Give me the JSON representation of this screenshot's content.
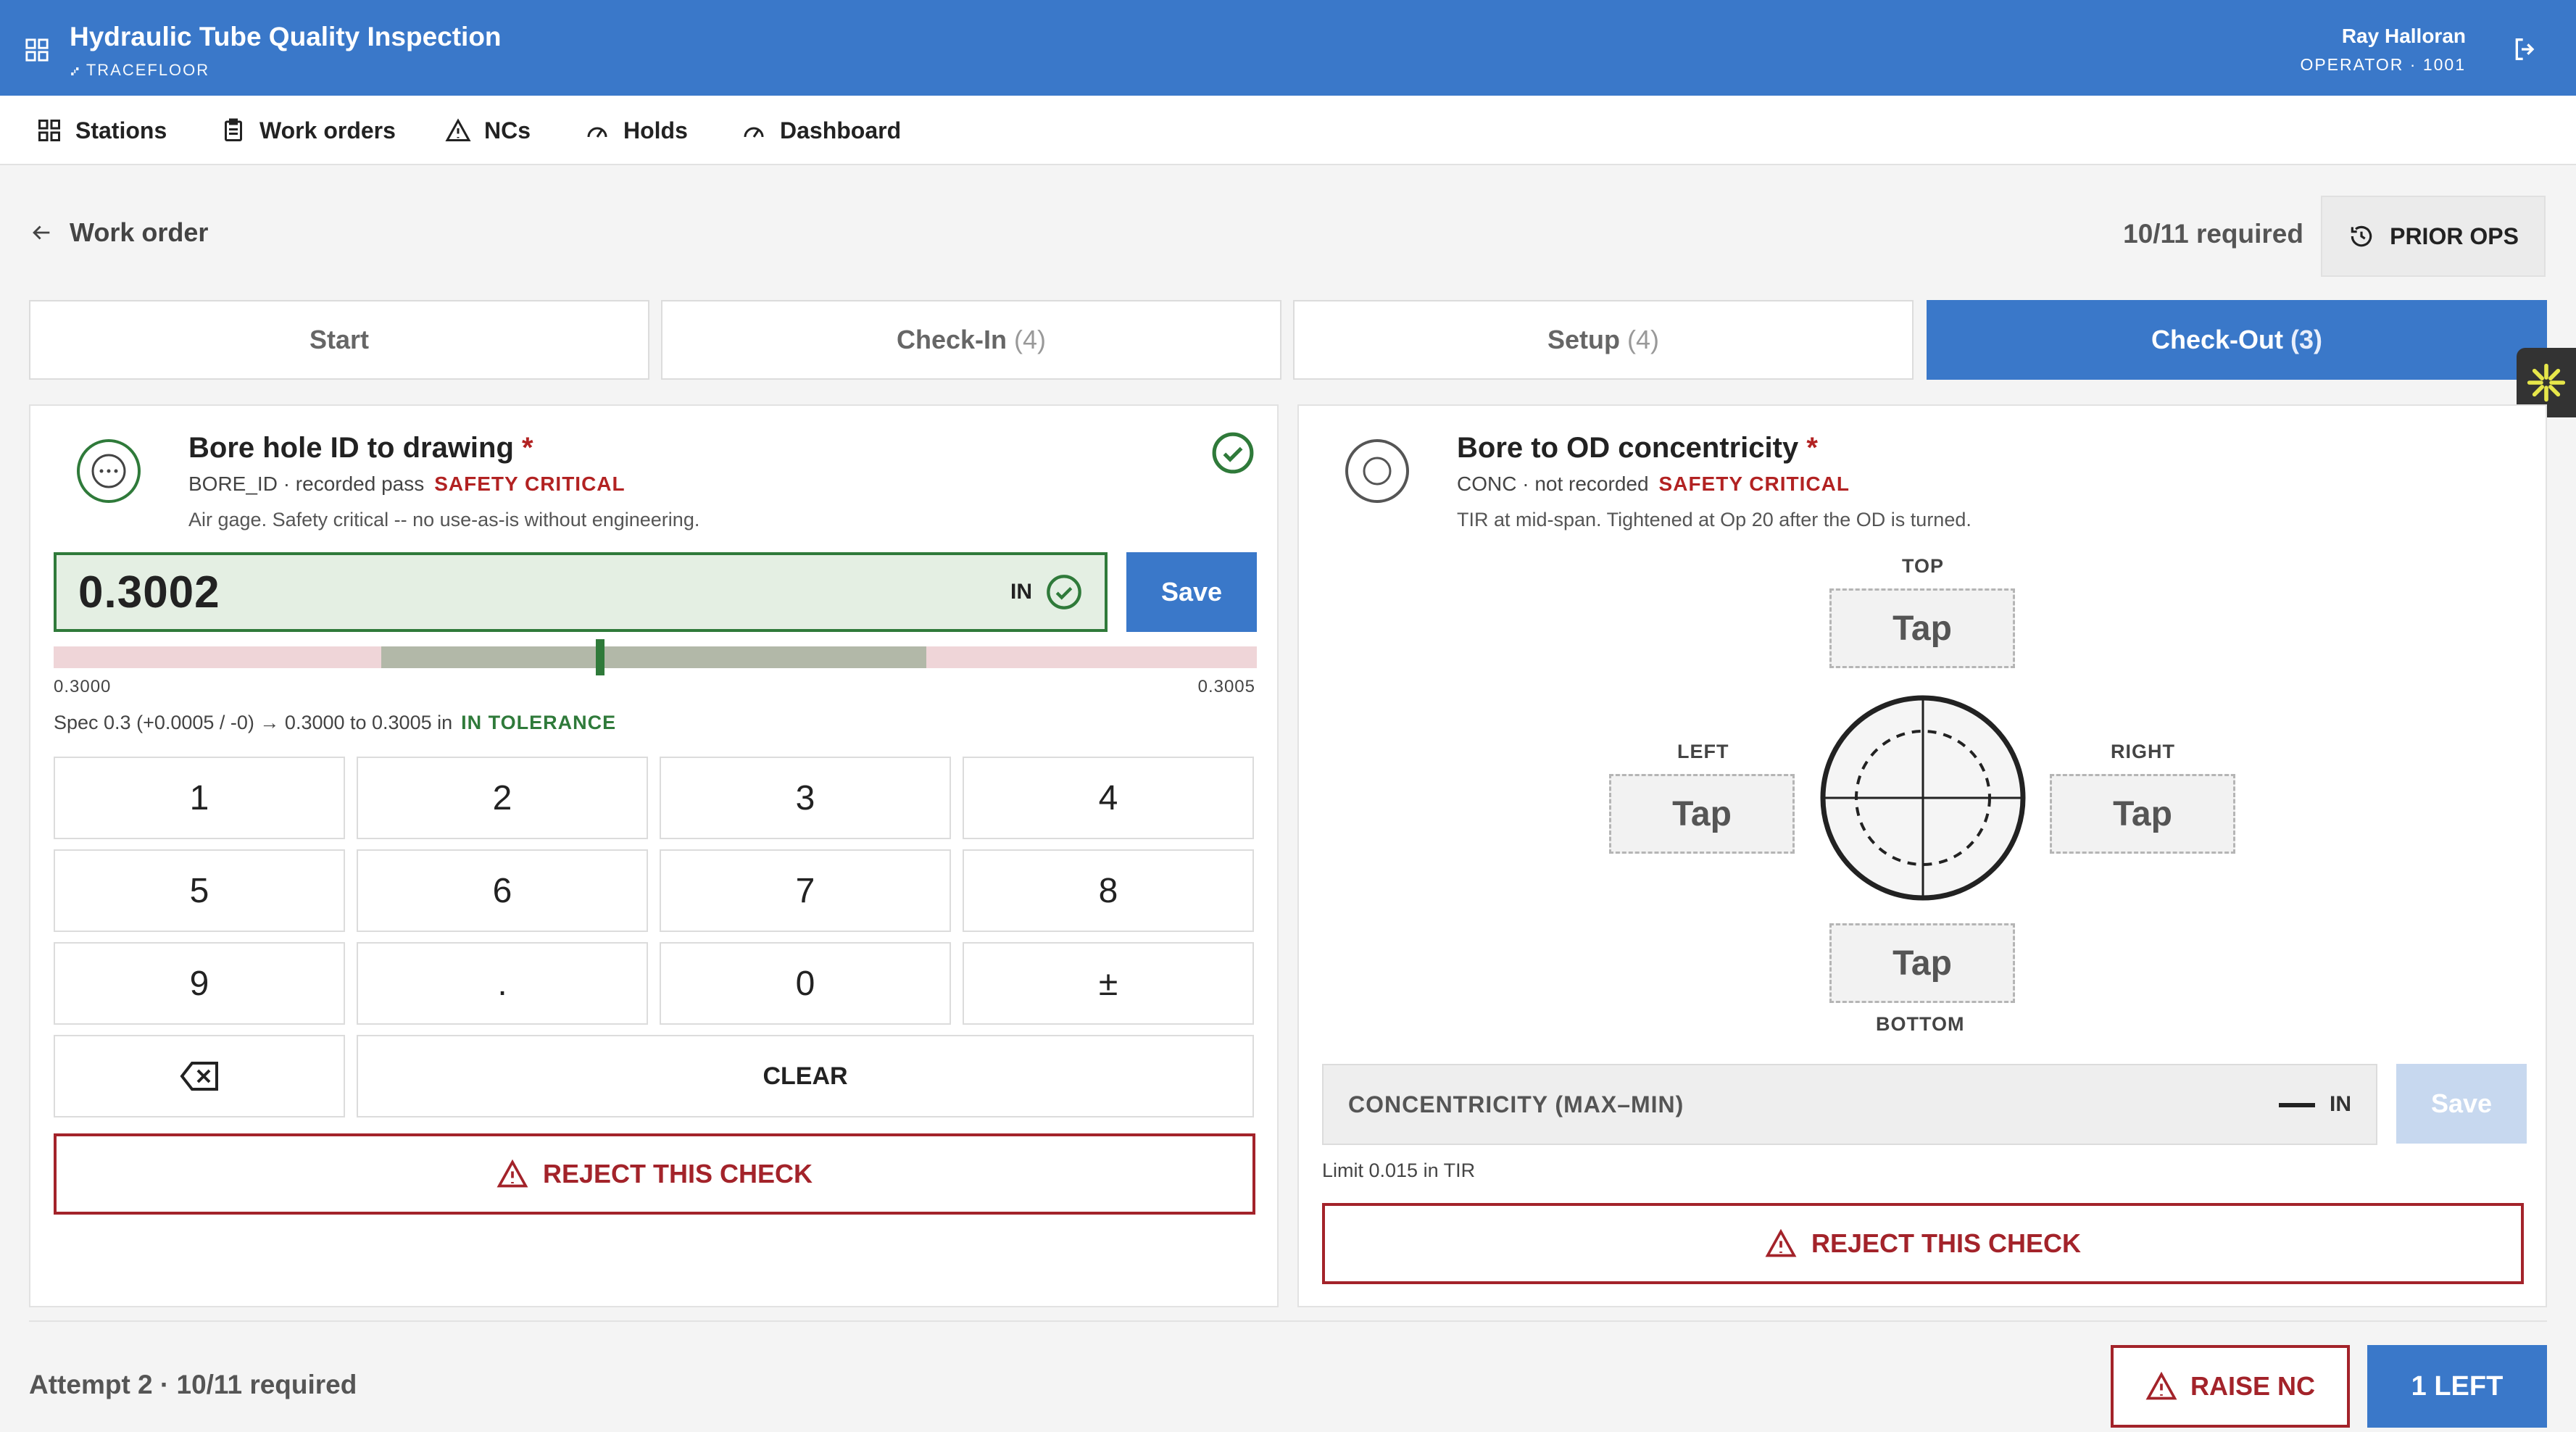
{
  "header": {
    "title": "Hydraulic Tube Quality Inspection",
    "subtitle": "TRACEFLOOR",
    "user_name": "Ray Halloran",
    "user_role": "OPERATOR · 1001"
  },
  "nav": {
    "items": [
      {
        "label": "Stations",
        "icon": "grid-icon"
      },
      {
        "label": "Work orders",
        "icon": "clipboard-icon"
      },
      {
        "label": "NCs",
        "icon": "warning-icon"
      },
      {
        "label": "Holds",
        "icon": "gauge-icon"
      },
      {
        "label": "Dashboard",
        "icon": "gauge-icon"
      }
    ]
  },
  "breadcrumb": {
    "back_label": "Work order"
  },
  "progress": {
    "required_label": "10/11 required"
  },
  "prior_ops_label": "PRIOR OPS",
  "tabs": [
    {
      "label": "Start",
      "count": ""
    },
    {
      "label": "Check-In",
      "count": "(4)"
    },
    {
      "label": "Setup",
      "count": "(4)"
    },
    {
      "label": "Check-Out",
      "count": "(3)",
      "active": true
    }
  ],
  "checks": {
    "bore": {
      "title": "Bore hole ID to drawing",
      "required_mark": "*",
      "meta": "BORE_ID · recorded pass",
      "critical": "SAFETY CRITICAL",
      "description": "Air gage. Safety critical -- no use-as-is without engineering.",
      "value": "0.3002",
      "unit": "IN",
      "save_label": "Save",
      "tol_min": "0.3000",
      "tol_max": "0.3005",
      "spec": "Spec 0.3 (+0.0005 / -0) → 0.3000 to 0.3005 in",
      "status": "IN TOLERANCE",
      "keypad": [
        "1",
        "2",
        "3",
        "4",
        "5",
        "6",
        "7",
        "8",
        "9",
        ".",
        "0",
        "±"
      ],
      "clear_label": "CLEAR",
      "reject_label": "REJECT THIS CHECK"
    },
    "conc": {
      "title": "Bore to OD concentricity",
      "required_mark": "*",
      "meta": "CONC · not recorded",
      "critical": "SAFETY CRITICAL",
      "description": "TIR at mid-span. Tightened at Op 20 after the OD is turned.",
      "top_label": "TOP",
      "left_label": "LEFT",
      "right_label": "RIGHT",
      "bottom_label": "BOTTOM",
      "tap_label": "Tap",
      "field_label": "CONCENTRICITY (MAX–MIN)",
      "unit": "IN",
      "save_label": "Save",
      "limit": "Limit 0.015 in TIR",
      "reject_label": "REJECT THIS CHECK"
    }
  },
  "footer": {
    "attempt": "Attempt 2 · 10/11 required",
    "raise_nc_label": "RAISE NC",
    "remaining_label": "1 LEFT"
  },
  "colors": {
    "primary": "#3a78c9",
    "danger": "#a3232a",
    "success": "#2f7a3a"
  }
}
